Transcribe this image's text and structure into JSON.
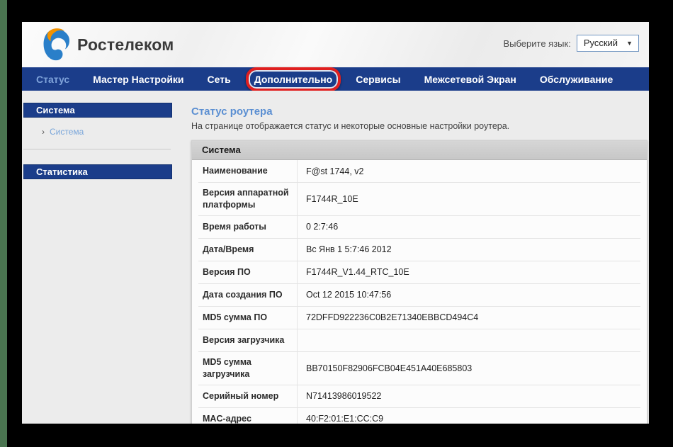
{
  "header": {
    "brand": "Ростелеком",
    "language_label": "Выберите язык:",
    "language_value": "Русский",
    "dropdown_arrow": "▼"
  },
  "nav": {
    "items": [
      {
        "label": "Статус",
        "active": true,
        "annotated": false
      },
      {
        "label": "Мастер Настройки",
        "active": false,
        "annotated": false
      },
      {
        "label": "Сеть",
        "active": false,
        "annotated": false
      },
      {
        "label": "Дополнительно",
        "active": false,
        "annotated": true
      },
      {
        "label": "Сервисы",
        "active": false,
        "annotated": false
      },
      {
        "label": "Межсетевой Экран",
        "active": false,
        "annotated": false
      },
      {
        "label": "Обслуживание",
        "active": false,
        "annotated": false
      }
    ]
  },
  "sidebar": {
    "sections": [
      {
        "title": "Система",
        "links": [
          {
            "bullet": "›",
            "label": "Система"
          }
        ]
      },
      {
        "title": "Статистика",
        "links": []
      }
    ]
  },
  "main": {
    "title": "Статус роутера",
    "subtitle": "На странице отображается статус и некоторые основные настройки роутера.",
    "table": {
      "header": "Система",
      "rows": [
        {
          "label": "Наименование",
          "value": "F@st 1744, v2"
        },
        {
          "label": "Версия аппаратной платформы",
          "value": "F1744R_10E"
        },
        {
          "label": "Время работы",
          "value": "0 2:7:46"
        },
        {
          "label": "Дата/Время",
          "value": "Вс Янв 1 5:7:46 2012"
        },
        {
          "label": "Версия ПО",
          "value": "F1744R_V1.44_RTC_10E"
        },
        {
          "label": "Дата создания ПО",
          "value": "Oct 12 2015 10:47:56"
        },
        {
          "label": "MD5 сумма ПО",
          "value": "72DFFD922236C0B2E71340EBBCD494C4"
        },
        {
          "label": "Версия загрузчика",
          "value": ""
        },
        {
          "label": "MD5 сумма загрузчика",
          "value": "BB70150F82906FCB04E451A40E685803"
        },
        {
          "label": "Серийный номер",
          "value": "N71413986019522"
        },
        {
          "label": "MAC-адрес",
          "value": "40:F2:01:E1:CC:C9"
        }
      ]
    }
  },
  "colors": {
    "nav_bg": "#1b3d8a",
    "active_tab": "#7fa3da",
    "link": "#7aa6da",
    "title": "#5b8fd2",
    "annotation": "#e01f1f",
    "table_header_bg": "#c7c7c7",
    "left_strip": "#4a7450",
    "logo_blue": "#2a7fc9",
    "logo_orange": "#f29200"
  }
}
